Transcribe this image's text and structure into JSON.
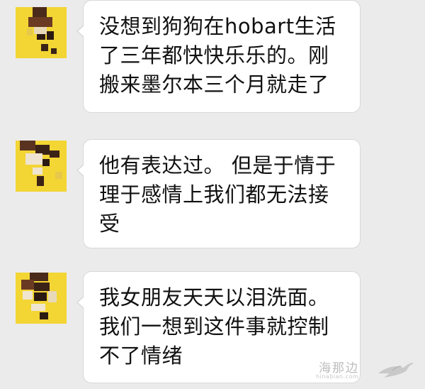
{
  "messages": [
    {
      "sender": "contact",
      "avatar_icon": "pixelated-avatar-icon",
      "text": "没想到狗狗在hobart生活\n了三年都快快乐乐的。刚\n搬来墨尔本三个月就走了"
    },
    {
      "sender": "contact",
      "avatar_icon": "pixelated-avatar-icon",
      "text": "他有表达过。 但是于情于\n理于感情上我们都无法接\n受"
    },
    {
      "sender": "contact",
      "avatar_icon": "pixelated-avatar-icon",
      "text": "我女朋友天天以泪洗面。\n我们一想到这件事就控制\n不了情绪"
    }
  ],
  "watermark": {
    "text": "海那边",
    "subtext": "hinabian.com",
    "icon": "bird-logo-icon"
  },
  "colors": {
    "background": "#ebebeb",
    "bubble": "#ffffff",
    "avatar_yellow": "#f3d534"
  }
}
